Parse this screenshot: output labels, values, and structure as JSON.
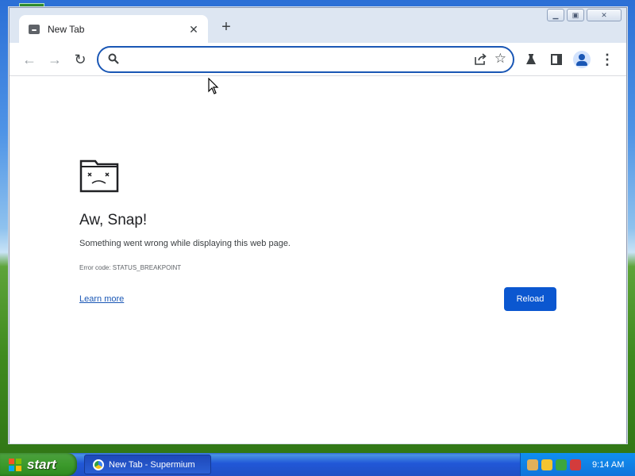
{
  "window": {
    "tab_title": "New Tab",
    "close_glyph": "✕",
    "new_tab_glyph": "+",
    "controls": {
      "minimize": "▁",
      "maximize": "▣",
      "close": "✕"
    }
  },
  "toolbar": {
    "back_glyph": "←",
    "forward_glyph": "→",
    "reload_glyph": "↻",
    "omnibox_value": "",
    "star_glyph": "☆",
    "menu_glyph": "⋮"
  },
  "error_page": {
    "title": "Aw, Snap!",
    "message": "Something went wrong while displaying this web page.",
    "error_code": "Error code: STATUS_BREAKPOINT",
    "learn_more": "Learn more",
    "reload_label": "Reload"
  },
  "taskbar": {
    "start_label": "start",
    "task_item": "New Tab - Supermium",
    "clock": "9:14 AM"
  },
  "colors": {
    "accent": "#0b57d0",
    "link": "#1a57b5",
    "xp_taskbar": "#2157d7",
    "xp_start": "#3c9a2c"
  },
  "icons": {
    "tab_favicon": "sad-tab-icon",
    "omnibox_left": "search-icon",
    "share": "share-icon",
    "bookmark": "star-icon",
    "labs": "flask-icon",
    "side_panel": "side-panel-icon",
    "profile": "profile-avatar-icon",
    "menu": "kebab-menu-icon"
  }
}
